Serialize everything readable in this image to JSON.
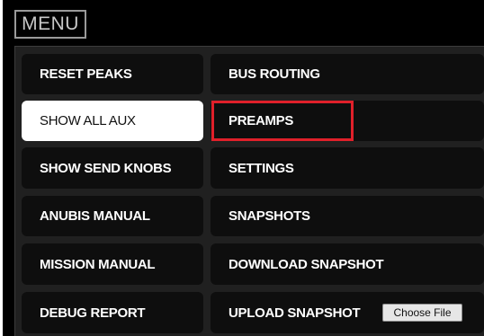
{
  "menu": {
    "title": "MENU"
  },
  "left_buttons": [
    {
      "label": "RESET PEAKS",
      "active": false
    },
    {
      "label": "SHOW ALL AUX",
      "active": true
    },
    {
      "label": "SHOW SEND KNOBS",
      "active": false
    },
    {
      "label": "ANUBIS MANUAL",
      "active": false
    },
    {
      "label": "MISSION MANUAL",
      "active": false
    },
    {
      "label": "DEBUG REPORT",
      "active": false
    }
  ],
  "right_buttons": [
    {
      "label": "BUS ROUTING"
    },
    {
      "label": "PREAMPS",
      "highlighted": true
    },
    {
      "label": "SETTINGS"
    },
    {
      "label": "SNAPSHOTS"
    },
    {
      "label": "DOWNLOAD SNAPSHOT"
    },
    {
      "label": "UPLOAD SNAPSHOT"
    }
  ],
  "upload": {
    "file_button_label": "Choose File"
  },
  "colors": {
    "background": "#000000",
    "panel": "#202020",
    "button": "#0e0e0e",
    "active_button": "#ffffff",
    "highlight_border": "#e0202a"
  }
}
